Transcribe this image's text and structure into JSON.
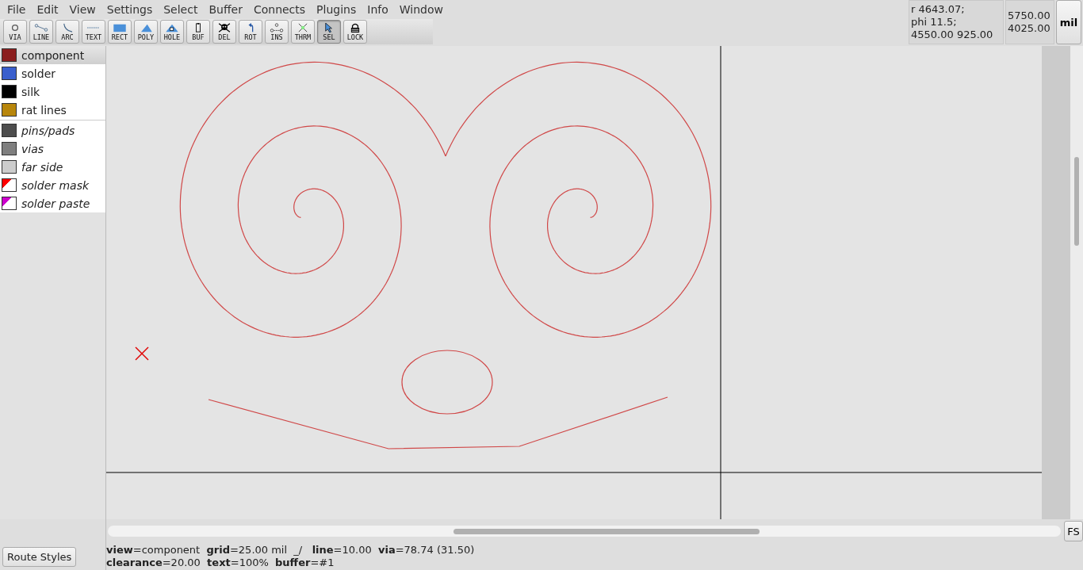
{
  "menu": [
    "File",
    "Edit",
    "View",
    "Settings",
    "Select",
    "Buffer",
    "Connects",
    "Plugins",
    "Info",
    "Window"
  ],
  "tools": [
    {
      "label": "VIA",
      "kind": "via",
      "selected": false
    },
    {
      "label": "LINE",
      "kind": "line",
      "selected": false
    },
    {
      "label": "ARC",
      "kind": "arc",
      "selected": false
    },
    {
      "label": "TEXT",
      "kind": "text",
      "selected": false
    },
    {
      "label": "RECT",
      "kind": "rect",
      "selected": false
    },
    {
      "label": "POLY",
      "kind": "poly",
      "selected": false
    },
    {
      "label": "HOLE",
      "kind": "hole",
      "selected": false
    },
    {
      "label": "BUF",
      "kind": "buf",
      "selected": false
    },
    {
      "label": "DEL",
      "kind": "del",
      "selected": false
    },
    {
      "label": "ROT",
      "kind": "rot",
      "selected": false
    },
    {
      "label": "INS",
      "kind": "ins",
      "selected": false
    },
    {
      "label": "THRM",
      "kind": "thrm",
      "selected": false
    },
    {
      "label": "SEL",
      "kind": "sel",
      "selected": true
    },
    {
      "label": "LOCK",
      "kind": "lock",
      "selected": false
    }
  ],
  "coordinates": {
    "relative": [
      "r 4643.07;",
      "phi 11.5;",
      "4550.00 925.00"
    ],
    "absolute": [
      "5750.00",
      "4025.00"
    ]
  },
  "units_button": "mil",
  "layers": [
    {
      "name": "component",
      "color": "#8b1e1e",
      "selected": true
    },
    {
      "name": "solder",
      "color": "#3a5fcd",
      "selected": false
    },
    {
      "name": "silk",
      "color": "#000000",
      "selected": false
    },
    {
      "name": "rat lines",
      "color": "#b8860b",
      "selected": false
    }
  ],
  "virtual_layers": [
    {
      "name": "pins/pads",
      "color": "#4d4d4d",
      "kind": "solid"
    },
    {
      "name": "vias",
      "color": "#7f7f7f",
      "kind": "solid"
    },
    {
      "name": "far side",
      "color": "#cccccc",
      "kind": "solid"
    },
    {
      "name": "solder mask",
      "color": "#ff0000",
      "kind": "corner"
    },
    {
      "name": "solder paste",
      "color": "#cc00cc",
      "kind": "corner"
    }
  ],
  "route_styles_button": "Route Styles",
  "fs_button": "FS",
  "status": [
    "**view**=component  **grid**=25.00 mil  _/   **line**=10.00  **via**=78.74 (31.50)",
    "**clearance**=20.00  **text**=100%  **buffer**=#1"
  ]
}
